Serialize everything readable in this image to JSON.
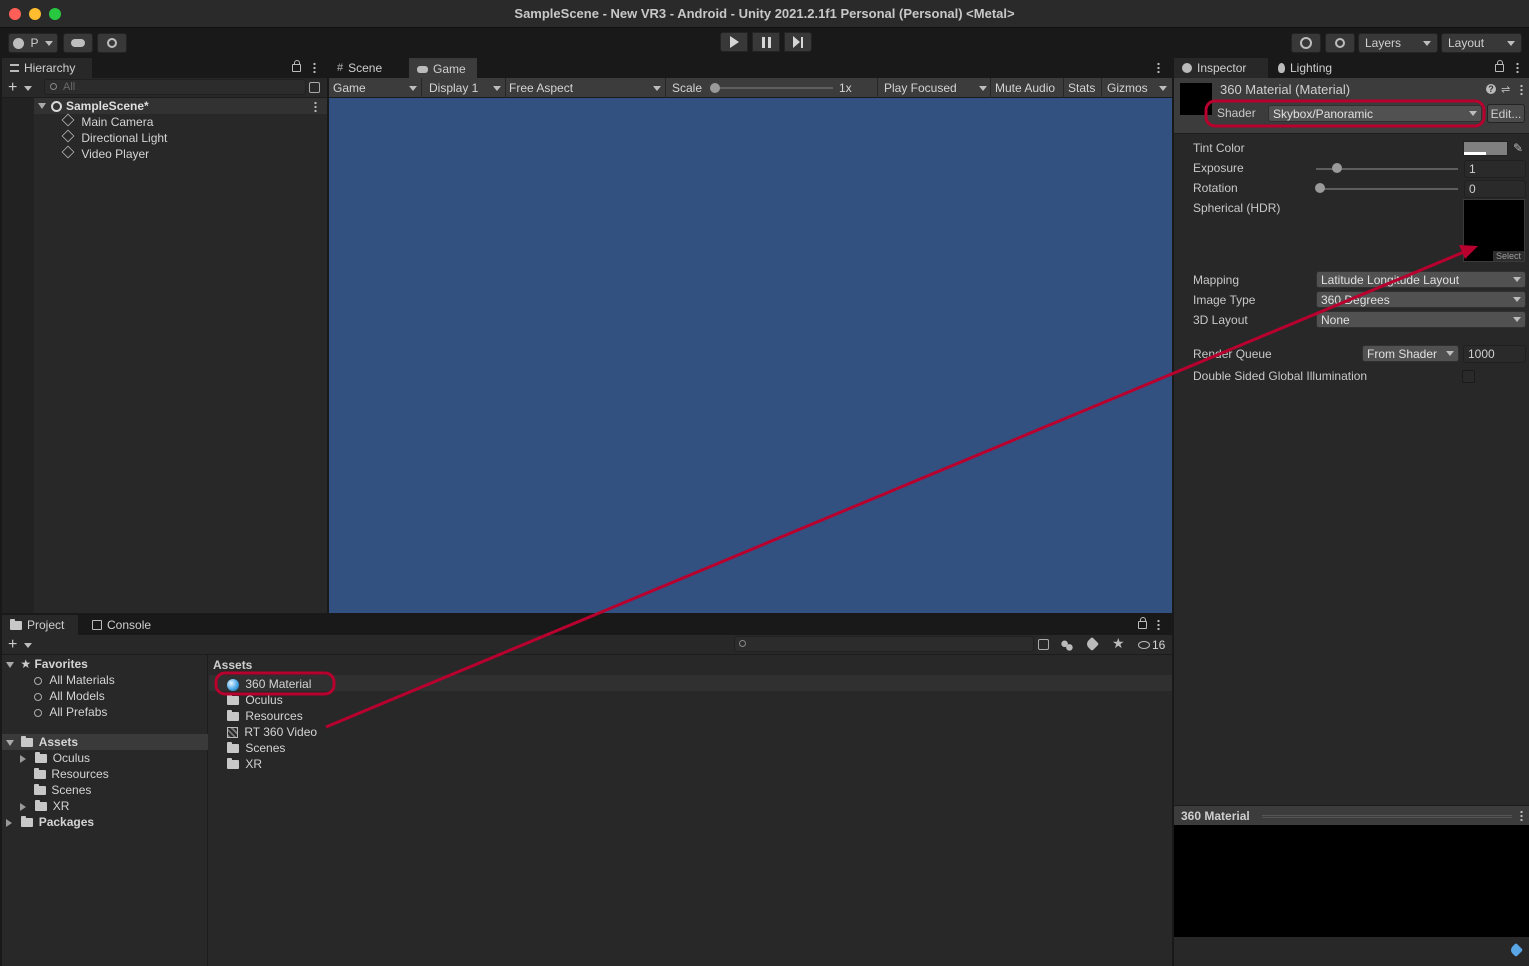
{
  "window": {
    "title": "SampleScene - New VR3 - Android - Unity 2021.2.1f1 Personal (Personal) <Metal>",
    "traffic_colors": [
      "#ff5f57",
      "#febc2e",
      "#28c840"
    ]
  },
  "toolbar": {
    "account_label": "P",
    "layers_label": "Layers",
    "layout_label": "Layout"
  },
  "hierarchy": {
    "tab": "Hierarchy",
    "search_placeholder": "All",
    "scene": "SampleScene*",
    "items": [
      "Main Camera",
      "Directional Light",
      "Video Player"
    ]
  },
  "game_view": {
    "tabs": [
      "Scene",
      "Game"
    ],
    "mode": "Game",
    "display": "Display 1",
    "aspect": "Free Aspect",
    "scale_label": "Scale",
    "scale_value": "1x",
    "play_focused": "Play Focused",
    "mute_audio": "Mute Audio",
    "stats": "Stats",
    "gizmos": "Gizmos",
    "background": "#325180"
  },
  "inspector": {
    "tabs": [
      "Inspector",
      "Lighting"
    ],
    "material_name": "360 Material (Material)",
    "shader_label": "Shader",
    "shader_value": "Skybox/Panoramic",
    "edit_button": "Edit...",
    "tint_label": "Tint Color",
    "exposure_label": "Exposure",
    "exposure_value": "1",
    "rotation_label": "Rotation",
    "rotation_value": "0",
    "spherical_label": "Spherical  (HDR)",
    "select_label": "Select",
    "mapping_label": "Mapping",
    "mapping_value": "Latitude Longitude Layout",
    "image_type_label": "Image Type",
    "image_type_value": "360 Degrees",
    "layout3d_label": "3D Layout",
    "layout3d_value": "None",
    "render_queue_label": "Render Queue",
    "render_queue_mode": "From Shader",
    "render_queue_value": "1000",
    "double_sided_label": "Double Sided Global Illumination",
    "preview_title": "360 Material"
  },
  "project": {
    "tabs": [
      "Project",
      "Console"
    ],
    "hidden_count": "16",
    "favorites_label": "Favorites",
    "favorites": [
      "All Materials",
      "All Models",
      "All Prefabs"
    ],
    "assets_label": "Assets",
    "asset_folders": [
      "Oculus",
      "Resources",
      "Scenes",
      "XR"
    ],
    "packages_label": "Packages",
    "breadcrumb": "Assets",
    "assets": [
      "360 Material",
      "Oculus",
      "Resources",
      "RT 360 Video",
      "Scenes",
      "XR"
    ]
  },
  "annotation_color": "#b8002e"
}
